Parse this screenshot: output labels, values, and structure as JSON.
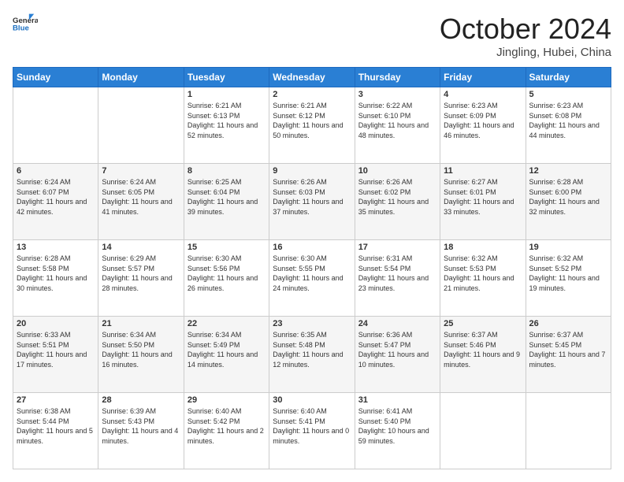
{
  "header": {
    "logo_line1": "General",
    "logo_line2": "Blue",
    "month": "October 2024",
    "location": "Jingling, Hubei, China"
  },
  "weekdays": [
    "Sunday",
    "Monday",
    "Tuesday",
    "Wednesday",
    "Thursday",
    "Friday",
    "Saturday"
  ],
  "weeks": [
    [
      {
        "day": "",
        "info": ""
      },
      {
        "day": "",
        "info": ""
      },
      {
        "day": "1",
        "info": "Sunrise: 6:21 AM\nSunset: 6:13 PM\nDaylight: 11 hours and 52 minutes."
      },
      {
        "day": "2",
        "info": "Sunrise: 6:21 AM\nSunset: 6:12 PM\nDaylight: 11 hours and 50 minutes."
      },
      {
        "day": "3",
        "info": "Sunrise: 6:22 AM\nSunset: 6:10 PM\nDaylight: 11 hours and 48 minutes."
      },
      {
        "day": "4",
        "info": "Sunrise: 6:23 AM\nSunset: 6:09 PM\nDaylight: 11 hours and 46 minutes."
      },
      {
        "day": "5",
        "info": "Sunrise: 6:23 AM\nSunset: 6:08 PM\nDaylight: 11 hours and 44 minutes."
      }
    ],
    [
      {
        "day": "6",
        "info": "Sunrise: 6:24 AM\nSunset: 6:07 PM\nDaylight: 11 hours and 42 minutes."
      },
      {
        "day": "7",
        "info": "Sunrise: 6:24 AM\nSunset: 6:05 PM\nDaylight: 11 hours and 41 minutes."
      },
      {
        "day": "8",
        "info": "Sunrise: 6:25 AM\nSunset: 6:04 PM\nDaylight: 11 hours and 39 minutes."
      },
      {
        "day": "9",
        "info": "Sunrise: 6:26 AM\nSunset: 6:03 PM\nDaylight: 11 hours and 37 minutes."
      },
      {
        "day": "10",
        "info": "Sunrise: 6:26 AM\nSunset: 6:02 PM\nDaylight: 11 hours and 35 minutes."
      },
      {
        "day": "11",
        "info": "Sunrise: 6:27 AM\nSunset: 6:01 PM\nDaylight: 11 hours and 33 minutes."
      },
      {
        "day": "12",
        "info": "Sunrise: 6:28 AM\nSunset: 6:00 PM\nDaylight: 11 hours and 32 minutes."
      }
    ],
    [
      {
        "day": "13",
        "info": "Sunrise: 6:28 AM\nSunset: 5:58 PM\nDaylight: 11 hours and 30 minutes."
      },
      {
        "day": "14",
        "info": "Sunrise: 6:29 AM\nSunset: 5:57 PM\nDaylight: 11 hours and 28 minutes."
      },
      {
        "day": "15",
        "info": "Sunrise: 6:30 AM\nSunset: 5:56 PM\nDaylight: 11 hours and 26 minutes."
      },
      {
        "day": "16",
        "info": "Sunrise: 6:30 AM\nSunset: 5:55 PM\nDaylight: 11 hours and 24 minutes."
      },
      {
        "day": "17",
        "info": "Sunrise: 6:31 AM\nSunset: 5:54 PM\nDaylight: 11 hours and 23 minutes."
      },
      {
        "day": "18",
        "info": "Sunrise: 6:32 AM\nSunset: 5:53 PM\nDaylight: 11 hours and 21 minutes."
      },
      {
        "day": "19",
        "info": "Sunrise: 6:32 AM\nSunset: 5:52 PM\nDaylight: 11 hours and 19 minutes."
      }
    ],
    [
      {
        "day": "20",
        "info": "Sunrise: 6:33 AM\nSunset: 5:51 PM\nDaylight: 11 hours and 17 minutes."
      },
      {
        "day": "21",
        "info": "Sunrise: 6:34 AM\nSunset: 5:50 PM\nDaylight: 11 hours and 16 minutes."
      },
      {
        "day": "22",
        "info": "Sunrise: 6:34 AM\nSunset: 5:49 PM\nDaylight: 11 hours and 14 minutes."
      },
      {
        "day": "23",
        "info": "Sunrise: 6:35 AM\nSunset: 5:48 PM\nDaylight: 11 hours and 12 minutes."
      },
      {
        "day": "24",
        "info": "Sunrise: 6:36 AM\nSunset: 5:47 PM\nDaylight: 11 hours and 10 minutes."
      },
      {
        "day": "25",
        "info": "Sunrise: 6:37 AM\nSunset: 5:46 PM\nDaylight: 11 hours and 9 minutes."
      },
      {
        "day": "26",
        "info": "Sunrise: 6:37 AM\nSunset: 5:45 PM\nDaylight: 11 hours and 7 minutes."
      }
    ],
    [
      {
        "day": "27",
        "info": "Sunrise: 6:38 AM\nSunset: 5:44 PM\nDaylight: 11 hours and 5 minutes."
      },
      {
        "day": "28",
        "info": "Sunrise: 6:39 AM\nSunset: 5:43 PM\nDaylight: 11 hours and 4 minutes."
      },
      {
        "day": "29",
        "info": "Sunrise: 6:40 AM\nSunset: 5:42 PM\nDaylight: 11 hours and 2 minutes."
      },
      {
        "day": "30",
        "info": "Sunrise: 6:40 AM\nSunset: 5:41 PM\nDaylight: 11 hours and 0 minutes."
      },
      {
        "day": "31",
        "info": "Sunrise: 6:41 AM\nSunset: 5:40 PM\nDaylight: 10 hours and 59 minutes."
      },
      {
        "day": "",
        "info": ""
      },
      {
        "day": "",
        "info": ""
      }
    ]
  ]
}
